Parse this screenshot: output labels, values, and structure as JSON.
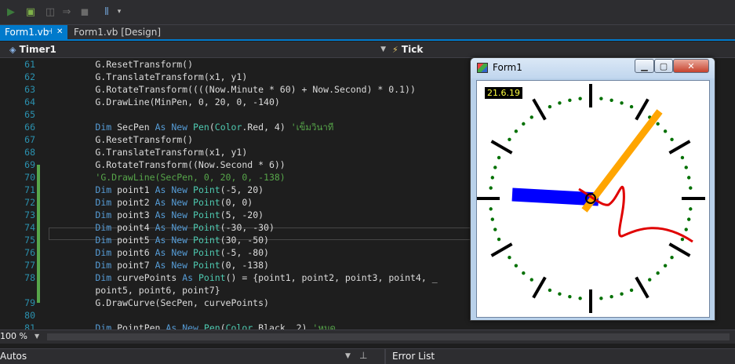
{
  "toolbar": {
    "icons": [
      "run-icon",
      "build-icon",
      "step-icon",
      "forward-icon",
      "stop-icon",
      "solution-explorer-icon",
      "dropdown-icon"
    ]
  },
  "tabs": [
    {
      "label": "Form1.vb",
      "active": true,
      "pin": "⊣",
      "close": "✕"
    },
    {
      "label": "Form1.vb [Design]",
      "active": false
    }
  ],
  "nav": {
    "left": "Timer1",
    "right": "Tick",
    "left_icon": "class-icon",
    "right_icon": "event-icon"
  },
  "code": [
    {
      "num": "61",
      "segments": [
        {
          "t": "        G.ResetTransform()",
          "c": ""
        }
      ]
    },
    {
      "num": "62",
      "segments": [
        {
          "t": "        G.TranslateTransform(x1, y1)",
          "c": ""
        }
      ]
    },
    {
      "num": "63",
      "segments": [
        {
          "t": "        G.RotateTransform((((Now.Minute * 60) + Now.Second) * 0.1))",
          "c": ""
        }
      ]
    },
    {
      "num": "64",
      "segments": [
        {
          "t": "        G.DrawLine(MinPen, 0, 20, 0, -140)",
          "c": ""
        }
      ]
    },
    {
      "num": "65",
      "segments": [
        {
          "t": "",
          "c": ""
        }
      ]
    },
    {
      "num": "66",
      "segments": [
        {
          "t": "        ",
          "c": ""
        },
        {
          "t": "Dim",
          "c": "kw"
        },
        {
          "t": " SecPen ",
          "c": ""
        },
        {
          "t": "As New",
          "c": "kw"
        },
        {
          "t": " ",
          "c": ""
        },
        {
          "t": "Pen",
          "c": "ty"
        },
        {
          "t": "(",
          "c": ""
        },
        {
          "t": "Color",
          "c": "ty"
        },
        {
          "t": ".Red, 4) ",
          "c": ""
        },
        {
          "t": "'เข็มวินาที",
          "c": "cm"
        }
      ]
    },
    {
      "num": "67",
      "segments": [
        {
          "t": "        G.ResetTransform()",
          "c": ""
        }
      ]
    },
    {
      "num": "68",
      "segments": [
        {
          "t": "        G.TranslateTransform(x1, y1)",
          "c": ""
        }
      ]
    },
    {
      "num": "69",
      "segments": [
        {
          "t": "        G.RotateTransform((Now.Second * 6))",
          "c": ""
        }
      ]
    },
    {
      "num": "70",
      "segments": [
        {
          "t": "        ",
          "c": ""
        },
        {
          "t": "'G.DrawLine(SecPen, 0, 20, 0, -138)",
          "c": "cm"
        }
      ]
    },
    {
      "num": "71",
      "segments": [
        {
          "t": "        ",
          "c": ""
        },
        {
          "t": "Dim",
          "c": "kw"
        },
        {
          "t": " point1 ",
          "c": ""
        },
        {
          "t": "As New",
          "c": "kw"
        },
        {
          "t": " ",
          "c": ""
        },
        {
          "t": "Point",
          "c": "ty"
        },
        {
          "t": "(-5, 20)",
          "c": ""
        }
      ]
    },
    {
      "num": "72",
      "segments": [
        {
          "t": "        ",
          "c": ""
        },
        {
          "t": "Dim",
          "c": "kw"
        },
        {
          "t": " point2 ",
          "c": ""
        },
        {
          "t": "As New",
          "c": "kw"
        },
        {
          "t": " ",
          "c": ""
        },
        {
          "t": "Point",
          "c": "ty"
        },
        {
          "t": "(0, 0)",
          "c": ""
        }
      ]
    },
    {
      "num": "73",
      "segments": [
        {
          "t": "        ",
          "c": ""
        },
        {
          "t": "Dim",
          "c": "kw"
        },
        {
          "t": " point3 ",
          "c": ""
        },
        {
          "t": "As New",
          "c": "kw"
        },
        {
          "t": " ",
          "c": ""
        },
        {
          "t": "Point",
          "c": "ty"
        },
        {
          "t": "(5, -20)",
          "c": ""
        }
      ]
    },
    {
      "num": "74",
      "segments": [
        {
          "t": "        ",
          "c": ""
        },
        {
          "t": "Dim",
          "c": "kw"
        },
        {
          "t": " point4 ",
          "c": ""
        },
        {
          "t": "As New",
          "c": "kw"
        },
        {
          "t": " ",
          "c": ""
        },
        {
          "t": "Point",
          "c": "ty"
        },
        {
          "t": "(-30, -30)",
          "c": ""
        }
      ]
    },
    {
      "num": "75",
      "segments": [
        {
          "t": "        ",
          "c": ""
        },
        {
          "t": "Dim",
          "c": "kw"
        },
        {
          "t": " point5 ",
          "c": ""
        },
        {
          "t": "As New",
          "c": "kw"
        },
        {
          "t": " ",
          "c": ""
        },
        {
          "t": "Point",
          "c": "ty"
        },
        {
          "t": "(30, -50)",
          "c": ""
        }
      ]
    },
    {
      "num": "76",
      "segments": [
        {
          "t": "        ",
          "c": ""
        },
        {
          "t": "Dim",
          "c": "kw"
        },
        {
          "t": " point6 ",
          "c": ""
        },
        {
          "t": "As New",
          "c": "kw"
        },
        {
          "t": " ",
          "c": ""
        },
        {
          "t": "Point",
          "c": "ty"
        },
        {
          "t": "(-5, -80)",
          "c": ""
        }
      ]
    },
    {
      "num": "77",
      "segments": [
        {
          "t": "        ",
          "c": ""
        },
        {
          "t": "Dim",
          "c": "kw"
        },
        {
          "t": " point7 ",
          "c": ""
        },
        {
          "t": "As New",
          "c": "kw"
        },
        {
          "t": " ",
          "c": ""
        },
        {
          "t": "Point",
          "c": "ty"
        },
        {
          "t": "(0, -138)",
          "c": ""
        }
      ]
    },
    {
      "num": "78",
      "segments": [
        {
          "t": "        ",
          "c": ""
        },
        {
          "t": "Dim",
          "c": "kw"
        },
        {
          "t": " curvePoints ",
          "c": ""
        },
        {
          "t": "As",
          "c": "kw"
        },
        {
          "t": " ",
          "c": ""
        },
        {
          "t": "Point",
          "c": "ty"
        },
        {
          "t": "() = {point1, point2, point3, point4, _",
          "c": ""
        }
      ]
    },
    {
      "num": "",
      "segments": [
        {
          "t": "        point5, point6, point7}",
          "c": ""
        }
      ]
    },
    {
      "num": "79",
      "segments": [
        {
          "t": "        G.DrawCurve(SecPen, curvePoints)",
          "c": ""
        }
      ]
    },
    {
      "num": "80",
      "segments": [
        {
          "t": "",
          "c": ""
        }
      ]
    },
    {
      "num": "81",
      "segments": [
        {
          "t": "        ",
          "c": ""
        },
        {
          "t": "Dim",
          "c": "kw"
        },
        {
          "t": " PointPen ",
          "c": ""
        },
        {
          "t": "As New",
          "c": "kw"
        },
        {
          "t": " ",
          "c": ""
        },
        {
          "t": "Pen",
          "c": "ty"
        },
        {
          "t": "(",
          "c": ""
        },
        {
          "t": "Color",
          "c": "ty"
        },
        {
          "t": ".Black, 2) ",
          "c": ""
        },
        {
          "t": "'หมุด",
          "c": "cm"
        }
      ]
    }
  ],
  "status": {
    "zoom": "100 %",
    "zoom_arrow": "▼"
  },
  "bottom": {
    "left_title": "Autos",
    "right_title": "Error List",
    "pin": "⊥",
    "dropdown": "▼"
  },
  "form": {
    "title": "Form1",
    "time_label": "21.6.19",
    "minimize": "▁",
    "maximize": "▢",
    "close": "✕",
    "colors": {
      "hour_hand": "#0000ff",
      "minute_hand": "#ffa500",
      "second_curve": "#e00000",
      "dots": "#007000",
      "ticks": "#000000"
    }
  }
}
